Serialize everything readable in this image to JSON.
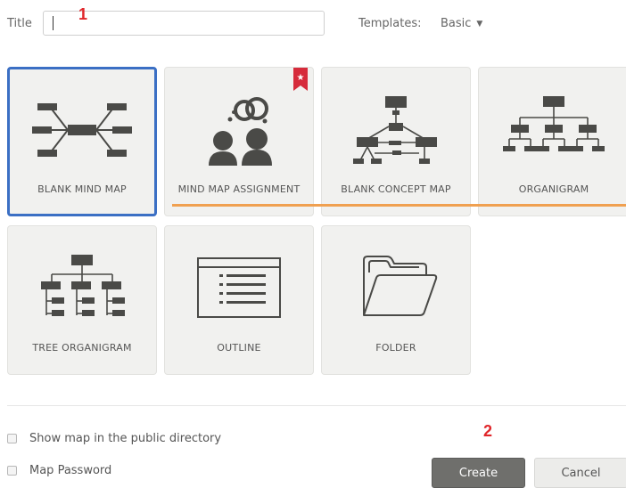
{
  "form": {
    "title_label": "Title",
    "title_value": "",
    "templates_label": "Templates:",
    "templates_value": "Basic"
  },
  "annotations": {
    "step1": "1",
    "step2": "2"
  },
  "tiles": [
    {
      "label": "BLANK MIND MAP",
      "icon": "mind-map-icon",
      "selected": true
    },
    {
      "label": "MIND MAP ASSIGNMENT",
      "icon": "assignment-icon",
      "badge": "star-ribbon"
    },
    {
      "label": "BLANK CONCEPT MAP",
      "icon": "concept-map-icon"
    },
    {
      "label": "ORGANIGRAM",
      "icon": "organigram-icon"
    },
    {
      "label": "TREE ORGANIGRAM",
      "icon": "tree-organigram-icon"
    },
    {
      "label": "OUTLINE",
      "icon": "outline-icon"
    },
    {
      "label": "FOLDER",
      "icon": "folder-icon"
    }
  ],
  "options": {
    "public_directory_label": "Show map in the public directory",
    "password_label": "Map Password"
  },
  "buttons": {
    "create": "Create",
    "cancel": "Cancel"
  },
  "colors": {
    "selected_border": "#3b6fc4",
    "ribbon": "#d62b3b",
    "highlight_line": "#f0a050",
    "annotation": "#e0262a",
    "icon": "#4a4a47"
  }
}
